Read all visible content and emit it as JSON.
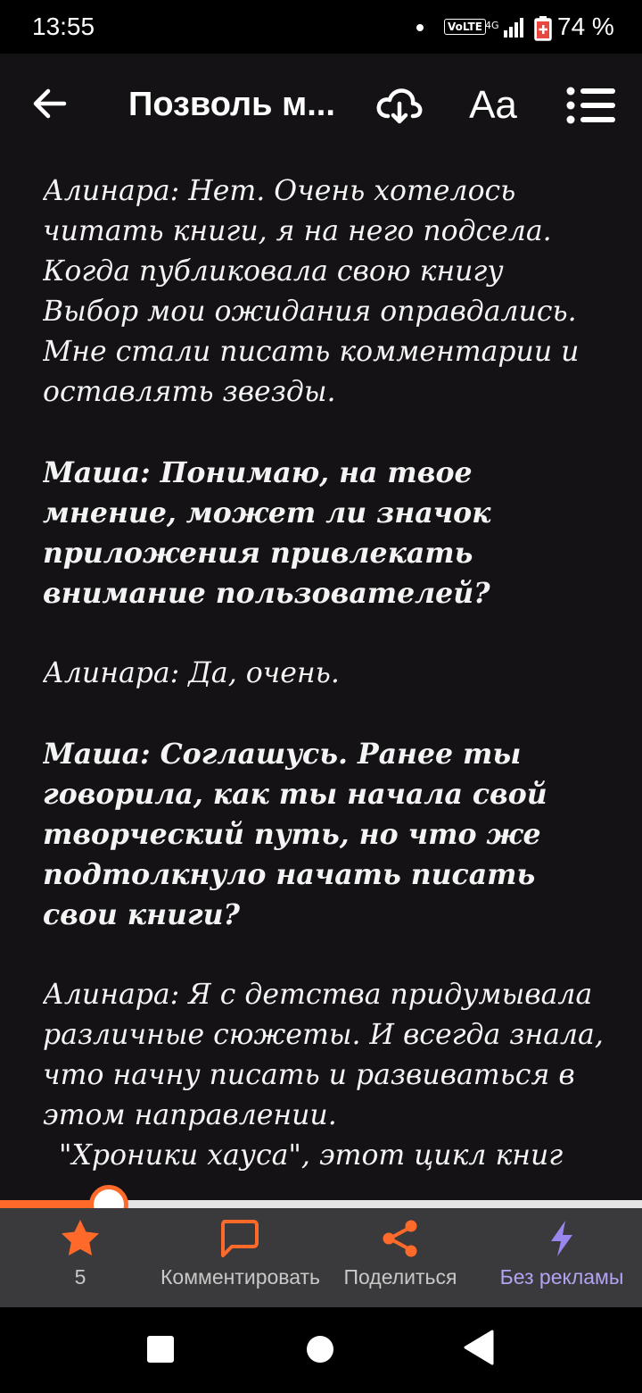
{
  "status_bar": {
    "time": "13:55",
    "network_badge": "VoLTE",
    "network_type": "4G",
    "battery_percent": "74 %",
    "battery_level": 0.74
  },
  "app_bar": {
    "title": "Позволь м...",
    "icons": [
      "back-arrow-icon",
      "cloud-download-icon",
      "font-size-icon",
      "toc-list-icon"
    ],
    "font_button_label": "Aa"
  },
  "content": {
    "paragraphs": [
      {
        "text": "Алинара: Нет. Очень хотелось читать книги, я на него подсела. Когда публиковала свою книгу Выбор мои ожидания оправдались. Мне стали писать комментарии и оставлять звезды.",
        "style": "answer"
      },
      {
        "text": "Маша: Понимаю, на твое мнение, может ли значок приложения привлекать внимание пользователей?",
        "style": "question"
      },
      {
        "text": "Алинара: Да, очень.",
        "style": "answer"
      },
      {
        "text": "Маша: Соглашусь. Ранее ты говорила, как ты начала свой творческий путь, но что же подтолкнуло начать писать свои книги?",
        "style": "question"
      },
      {
        "text": "Алинара: Я с детства придумывала различные сюжеты. И всегда знала, что начну писать и развиваться в этом направлении.",
        "style": "answer-nomargin"
      },
      {
        "text": "\"Хроники хауса\", этот цикл книг",
        "style": "continuation"
      }
    ]
  },
  "progress": {
    "value": 0.165,
    "accent": "#ff6a2b"
  },
  "actions": {
    "star": {
      "icon": "star-icon",
      "label": "5",
      "color": "#ff6a2b"
    },
    "comment": {
      "icon": "comment-icon",
      "label": "Комментировать",
      "color": "#ff6a2b"
    },
    "share": {
      "icon": "share-icon",
      "label": "Поделиться",
      "color": "#ff6a2b"
    },
    "no_ads": {
      "icon": "lightning-icon",
      "label": "Без рекламы",
      "color": "#9b86ee"
    }
  },
  "nav_bar": {
    "icons": [
      "recent-apps-icon",
      "home-icon",
      "back-triangle-icon"
    ]
  }
}
